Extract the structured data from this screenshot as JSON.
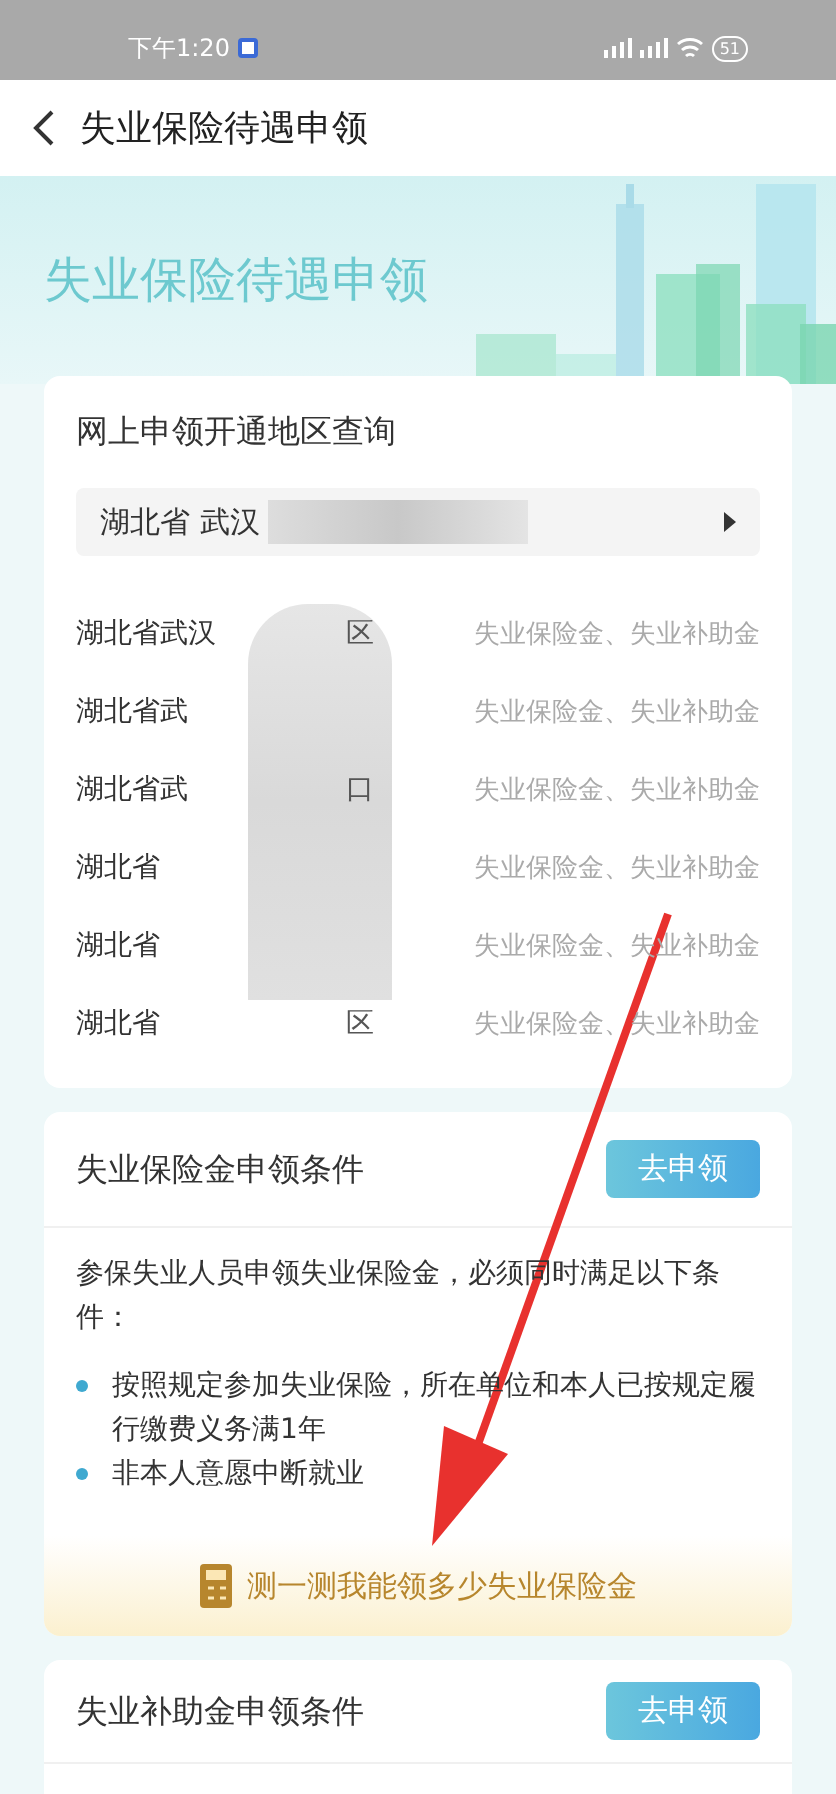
{
  "status_bar": {
    "time": "下午1:20",
    "battery": "51"
  },
  "header": {
    "title": "失业保险待遇申领"
  },
  "hero": {
    "title": "失业保险待遇申领"
  },
  "region_card": {
    "title": "网上申领开通地区查询",
    "selector": {
      "value": "湖北省 武汉"
    },
    "rows": [
      {
        "region": "湖北省武汉",
        "tail": "区",
        "benefits": "失业保险金、失业补助金"
      },
      {
        "region": "湖北省武",
        "tail": "",
        "benefits": "失业保险金、失业补助金"
      },
      {
        "region": "湖北省武",
        "tail": "口",
        "benefits": "失业保险金、失业补助金"
      },
      {
        "region": "湖北省",
        "tail": "",
        "benefits": "失业保险金、失业补助金"
      },
      {
        "region": "湖北省",
        "tail": "",
        "benefits": "失业保险金、失业补助金"
      },
      {
        "region": "湖北省",
        "tail": "区",
        "benefits": "失业保险金、失业补助金"
      }
    ]
  },
  "insurance_card": {
    "title": "失业保险金申领条件",
    "button": "去申领",
    "intro": "参保失业人员申领失业保险金，必须同时满足以下条件：",
    "conditions": [
      "按照规定参加失业保险，所在单位和本人已按规定履行缴费义务满1年",
      "非本人意愿中断就业"
    ],
    "calculator_link": "测一测我能领多少失业保险金"
  },
  "subsidy_card": {
    "title": "失业补助金申领条件",
    "button": "去申领"
  }
}
